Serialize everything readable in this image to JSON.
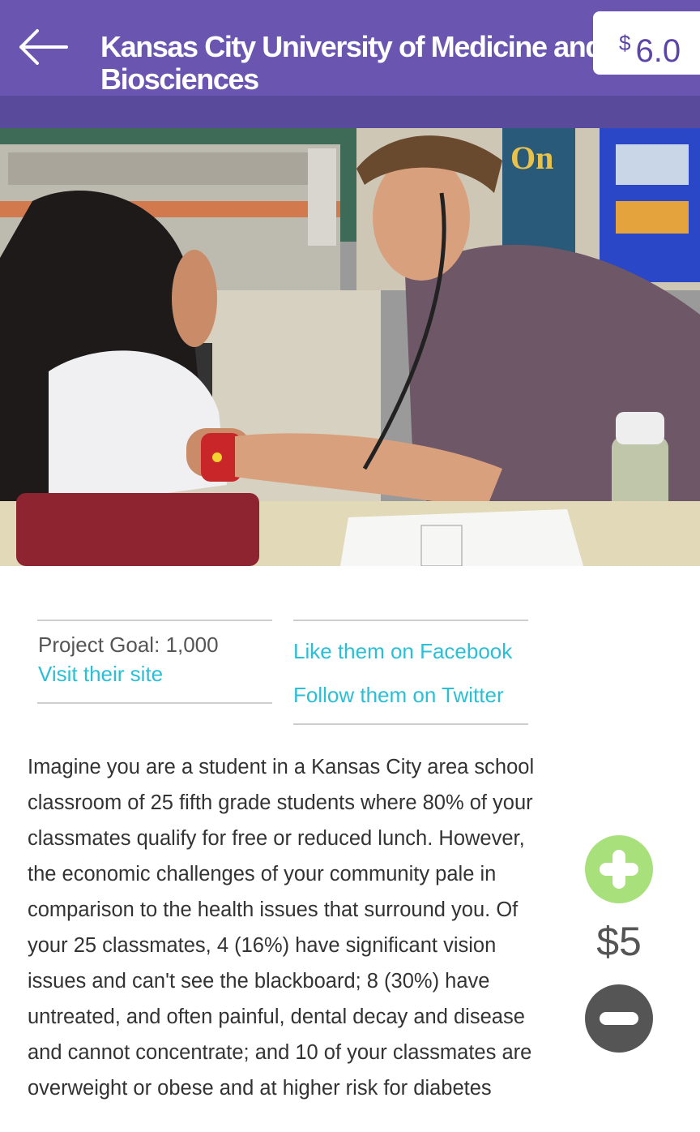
{
  "header": {
    "title_line1": "Kansas City University of Medicine and",
    "title_line2": "Biosciences",
    "balance_currency": "$",
    "balance_value": "6.0"
  },
  "hero": {
    "sign_text": "On"
  },
  "project": {
    "goal": "Project Goal: 1,000",
    "visit_link": "Visit their site",
    "facebook_link": "Like them on Facebook",
    "twitter_link": "Follow them on Twitter"
  },
  "description": "Imagine you are a student in a Kansas City area school classroom of 25 fifth grade students where 80% of your classmates qualify for free or reduced lunch. However, the economic challenges of your community pale in comparison to the health issues that surround you. Of your 25 classmates, 4 (16%) have significant vision issues and can't see the blackboard; 8 (30%) have untreated, and often painful, dental decay and disease and cannot concentrate; and 10 of your classmates are overweight or obese and at higher risk for diabetes",
  "donation": {
    "amount": "$5"
  },
  "colors": {
    "header": "#6a55b0",
    "accent_link": "#2bbfd6",
    "plus": "#a8e07c",
    "minus": "#555555"
  }
}
